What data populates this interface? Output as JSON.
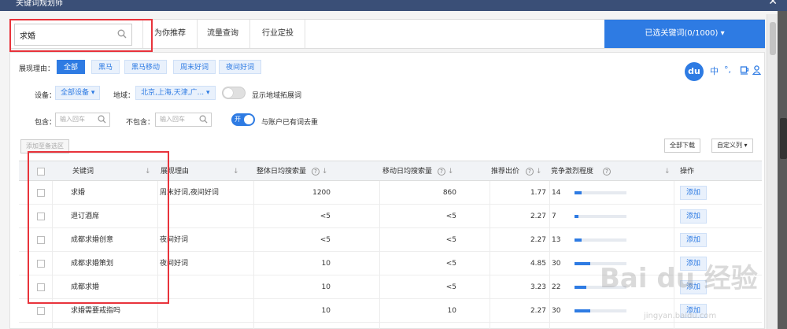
{
  "window": {
    "title": "关键词规划师",
    "close_icon": "close-icon"
  },
  "toolbar": {
    "search_value": "求婚",
    "tabs": [
      "为你推荐",
      "流量查询",
      "行业定投"
    ],
    "selected_keywords": "已选关键词(0/1000)"
  },
  "filters": {
    "reason_label": "展现理由：",
    "reason_chips": [
      "全部",
      "黑马",
      "黑马移动",
      "周末好词",
      "夜间好词"
    ],
    "device_label": "设备：",
    "device_value": "全部设备",
    "region_label": "地域：",
    "region_value": "北京,上海,天津,广...",
    "show_region_label": "显示地域拓展词",
    "include_label": "包含：",
    "include_placeholder": "输入回车",
    "exclude_label": "不包含：",
    "exclude_placeholder": "输入回车",
    "dedupe_toggle": "开",
    "dedupe_label": "与账户已有词去重"
  },
  "actions": {
    "add_to_pool": "添加至备选区",
    "download_all": "全部下载",
    "custom_columns": "自定义列"
  },
  "table": {
    "headers": {
      "keyword": "关键词",
      "reason": "展现理由",
      "daily_search": "整体日均搜索量",
      "mobile_search": "移动日均搜索量",
      "bid": "推荐出价",
      "competition": "竞争激烈程度",
      "action": "操作"
    },
    "add_label": "添加",
    "rows": [
      {
        "keyword": "求婚",
        "reason": "周末好词,夜间好词",
        "daily": "1200",
        "mobile": "860",
        "bid": "1.77",
        "comp": "14",
        "comp_frac": 0.14
      },
      {
        "keyword": "退订酒席",
        "reason": "",
        "daily": "<5",
        "mobile": "<5",
        "bid": "2.27",
        "comp": "7",
        "comp_frac": 0.07
      },
      {
        "keyword": "成都求婚创意",
        "reason": "夜间好词",
        "daily": "<5",
        "mobile": "<5",
        "bid": "2.27",
        "comp": "13",
        "comp_frac": 0.13
      },
      {
        "keyword": "成都求婚策划",
        "reason": "夜间好词",
        "daily": "10",
        "mobile": "<5",
        "bid": "4.85",
        "comp": "30",
        "comp_frac": 0.3
      },
      {
        "keyword": "成都求婚",
        "reason": "",
        "daily": "10",
        "mobile": "<5",
        "bid": "3.23",
        "comp": "22",
        "comp_frac": 0.22
      },
      {
        "keyword": "求婚需要戒指吗",
        "reason": "",
        "daily": "10",
        "mobile": "10",
        "bid": "2.27",
        "comp": "30",
        "comp_frac": 0.3
      }
    ]
  },
  "du_toolbar": {
    "logo": "du",
    "items": [
      "中",
      "°,"
    ]
  },
  "watermark": {
    "main": "Bai du 经验",
    "sub": "jingyan.baidu.com"
  }
}
